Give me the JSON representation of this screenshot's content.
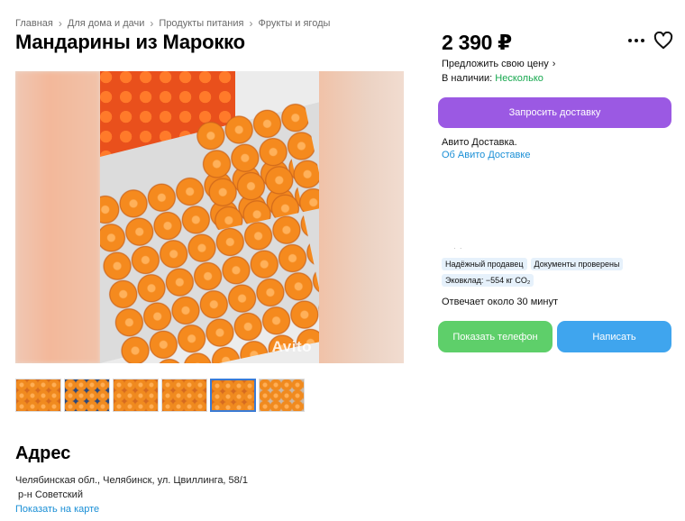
{
  "breadcrumbs": [
    "Главная",
    "Для дома и дачи",
    "Продукты питания",
    "Фрукты и ягоды"
  ],
  "title": "Мандарины из Марокко",
  "gallery": {
    "watermark": "Avito"
  },
  "address": {
    "title": "Адрес",
    "line": "Челябинская обл., Челябинск, ул. Цвиллинга, 58/1",
    "district": "р-н Советский",
    "map_link": "Показать на карте"
  },
  "price": "2 390 ₽",
  "offer_price": "Предложить свою цену",
  "stock": {
    "label": "В наличии:",
    "value": "Несколько"
  },
  "delivery_button": "Запросить доставку",
  "avito_delivery": "Авито Доставка.",
  "avito_about": "Об Авито Доставке",
  "badges": [
    "Надёжный продавец",
    "Документы проверены",
    "Эковклад: −554 кг CO₂"
  ],
  "reply_time": "Отвечает около 30 минут",
  "phone_button": "Показать телефон",
  "write_button": "Написать",
  "colors": {
    "accent_purple": "#9b59e3",
    "green": "#5ecf6a",
    "blue": "#3fa5ee",
    "link": "#1a8fd6"
  }
}
